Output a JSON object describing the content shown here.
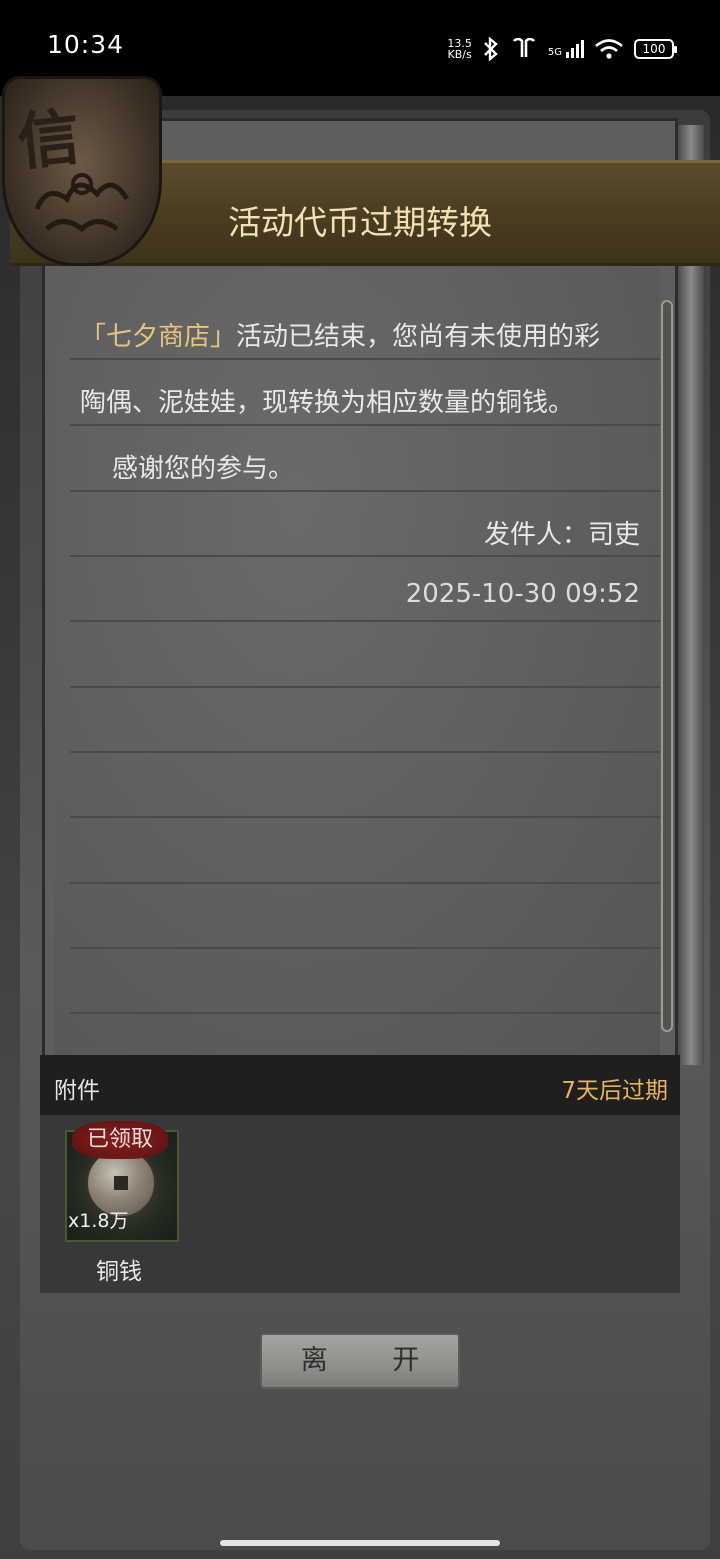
{
  "status_bar": {
    "time": "10:34",
    "net_speed_value": "13.5",
    "net_speed_unit": "KB/s",
    "signal_label": "5G",
    "battery": "100"
  },
  "seal": {
    "char": "信"
  },
  "mail": {
    "title": "活动代币过期转换",
    "line1_highlight": "「七夕商店」",
    "line1_rest": "活动已结束，您尚有未使用的彩",
    "line2": "陶偶、泥娃娃，现转换为相应数量的铜钱。",
    "line3": "感谢您的参与。",
    "sender": "发件人：司吏",
    "timestamp": "2025-10-30 09:52"
  },
  "attachments": {
    "label": "附件",
    "expiry": "7天后过期",
    "items": [
      {
        "name": "铜钱",
        "quantity": "x1.8万",
        "status": "已领取"
      }
    ]
  },
  "actions": {
    "leave_label": "离 开"
  },
  "colors": {
    "accent": "#e6c47b",
    "expiry": "#e8b35a",
    "header": "#4a3e22",
    "claimed_badge": "#8a1f1f"
  }
}
